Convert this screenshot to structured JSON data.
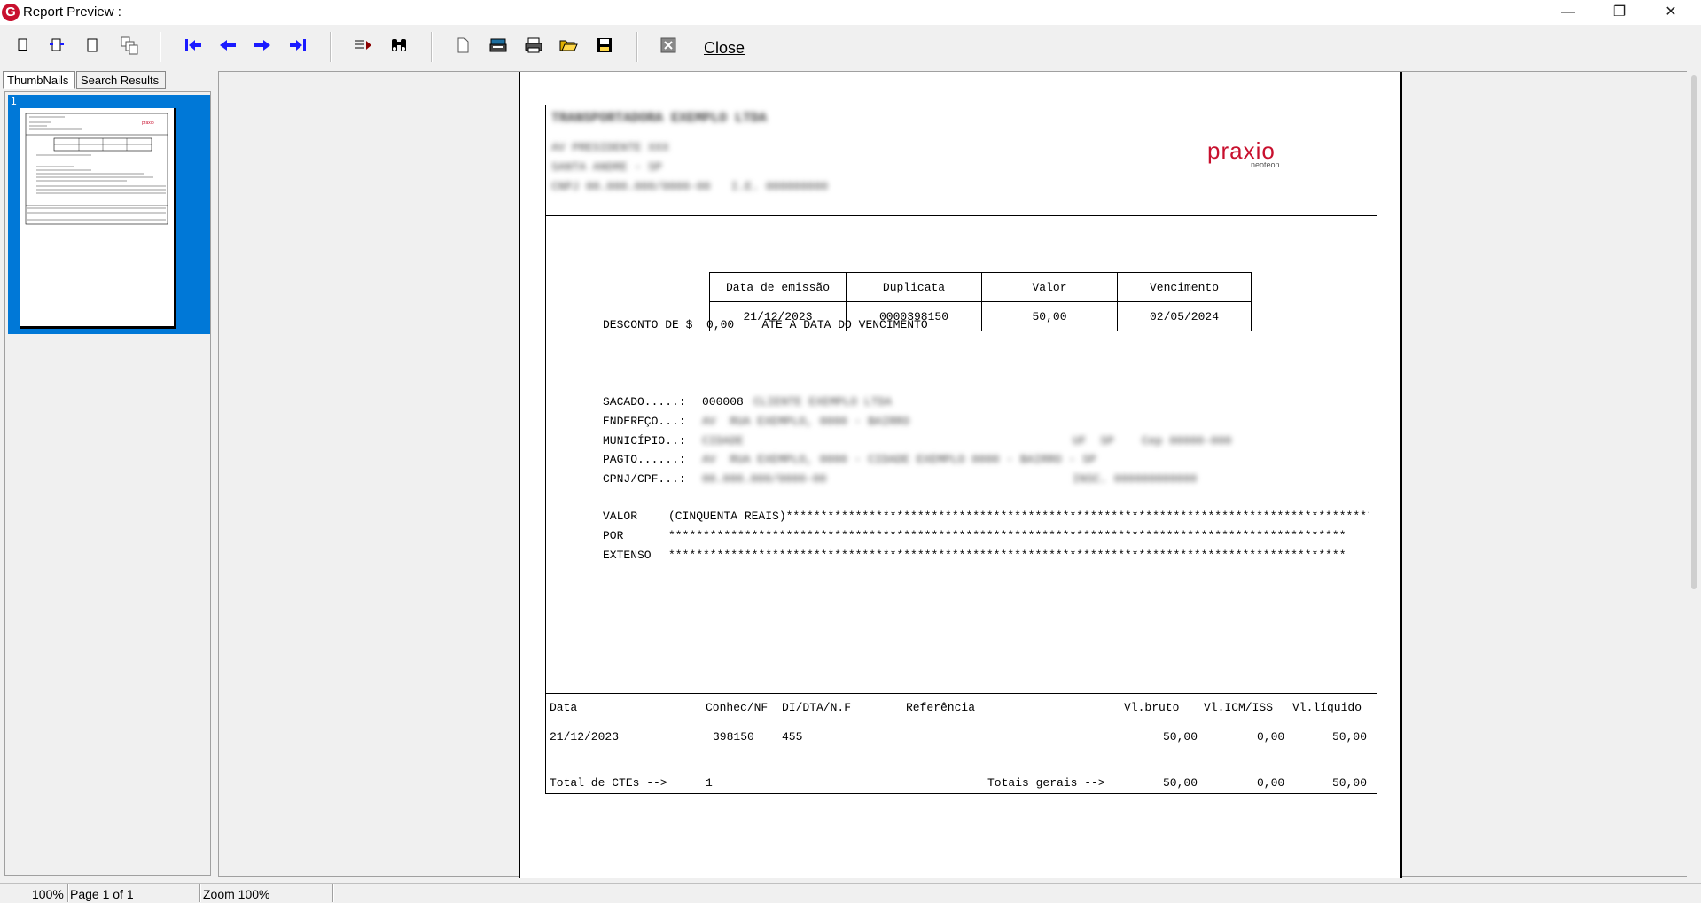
{
  "window": {
    "title": "Report Preview :",
    "app_icon_letter": "G",
    "minimize": "—",
    "restore": "❐",
    "close": "✕"
  },
  "toolbar": {
    "close_label": "Close",
    "accent_color": "#1a1aff"
  },
  "tabs": {
    "thumbnails": "ThumbNails",
    "search_results": "Search Results"
  },
  "thumbnail": {
    "page_number": "1"
  },
  "report": {
    "company_blur_1": "TRANSPORTADORA EXEMPLO LTDA",
    "company_blur_2": "AV PRESIDENTE XXX",
    "company_blur_3": "SANTA ANDRE - SP",
    "company_blur_4": "CNPJ 00.000.000/0000-00   I.E. 000000000",
    "logo_text": "praxio",
    "logo_sub": "neoteon",
    "table_headers": [
      "Data de emissão",
      "Duplicata",
      "Valor",
      "Vencimento"
    ],
    "table_values": [
      "21/12/2023",
      "0000398150",
      "50,00",
      "02/05/2024"
    ],
    "discount_line": "DESCONTO DE $  0,00    ATÉ A DATA DO VENCIMENTO",
    "sacado_label": "SACADO.....: ",
    "sacado_code": "000008",
    "sacado_blur": "CLIENTE EXEMPLO LTDA",
    "endereco_label": "ENDEREÇO...: ",
    "endereco_blur": "AV  RUA EXEMPLO, 0000 - BAIRRO",
    "municipio_label": "MUNICÍPIO..: ",
    "municipio_blur": "CIDADE",
    "municipio_blur2": "UF  SP    Cep 00000-000",
    "pagto_label": "PAGTO......: ",
    "pagto_blur": "AV  RUA EXEMPLO, 0000 - CIDADE EXEMPLO 0000 - BAIRRO - SP",
    "cnpj_label": "CPNJ/CPF...: ",
    "cnpj_blur": "00.000.000/0000-00",
    "cnpj_blur2": "INSC. 000000000000",
    "valor_label": "VALOR",
    "valor_text": "(CINQUENTA REAIS)***************************************************************************************",
    "por_label": "POR",
    "por_text": "**************************************************************************************************",
    "extenso_label": "EXTENSO",
    "extenso_text": "**************************************************************************************************",
    "detail_headers": {
      "data": "Data",
      "conhec": "Conhec/NF",
      "di": "DI/DTA/N.F",
      "ref": "Referência",
      "bruto": "Vl.bruto",
      "icm": "Vl.ICM/ISS",
      "liquido": "Vl.líquido"
    },
    "detail_row": {
      "data": "21/12/2023",
      "conhec": "398150",
      "di": "455",
      "bruto": "50,00",
      "icm": "0,00",
      "liquido": "50,00"
    },
    "total_label": "Total de CTEs -->",
    "total_count": "1",
    "totais_label": "Totais gerais -->",
    "totais_bruto": "50,00",
    "totais_icm": "0,00",
    "totais_liquido": "50,00"
  },
  "status": {
    "zoom_pct": "100%",
    "page": "Page 1 of 1",
    "zoom_label": "Zoom 100%"
  }
}
